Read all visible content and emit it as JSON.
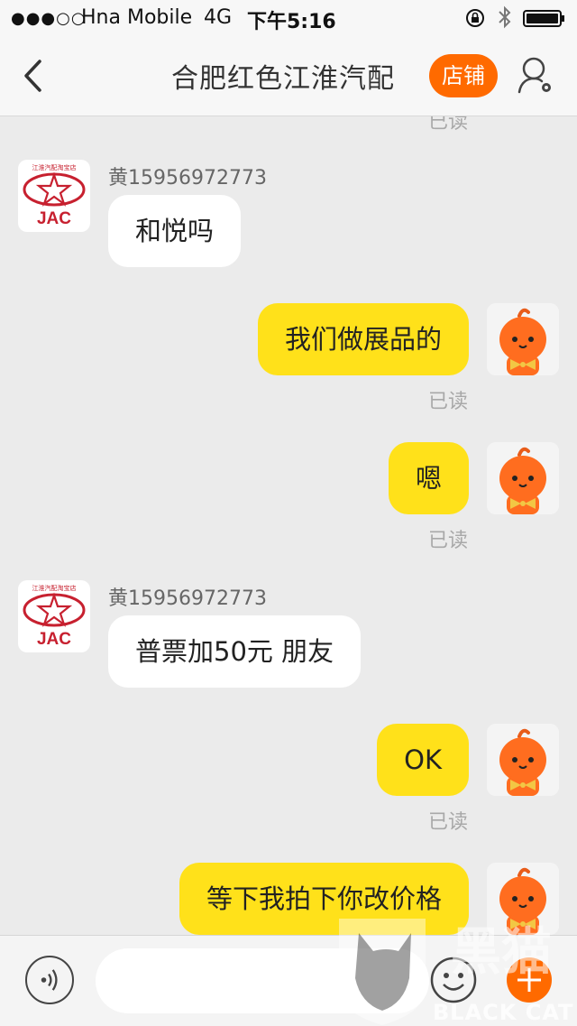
{
  "status_bar": {
    "signal": "●●●○○",
    "carrier": "Hna Mobile",
    "network": "4G",
    "time": "下午5:16"
  },
  "nav": {
    "title": "合肥红色江淮汽配",
    "shop_button": "店铺",
    "back_icon": "chevron-left-icon",
    "user_icon": "user-settings-icon"
  },
  "logo": {
    "brand": "JAC",
    "store_caption": "江淮汽配淘宝店"
  },
  "messages": [
    {
      "side": "out",
      "read": "已读"
    },
    {
      "side": "in",
      "sender": "黄15956972773",
      "text": "和悦吗"
    },
    {
      "side": "out",
      "text": "我们做展品的",
      "read": "已读"
    },
    {
      "side": "out",
      "text": "嗯",
      "read": "已读"
    },
    {
      "side": "in",
      "sender": "黄15956972773",
      "text": "普票加50元 朋友"
    },
    {
      "side": "out",
      "text": "OK",
      "read": "已读"
    },
    {
      "side": "out",
      "text": "等下我拍下你改价格"
    }
  ],
  "input_bar": {
    "placeholder": "",
    "voice_icon": "voice-icon",
    "emoji_icon": "emoji-icon",
    "plus_icon": "plus-icon"
  },
  "watermark": {
    "chinese": "黑猫",
    "english": "BLACK CAT"
  },
  "colors": {
    "accent": "#ff6a00",
    "outgoing_bubble": "#ffe11a",
    "incoming_bubble": "#ffffff",
    "background": "#ebebeb"
  }
}
